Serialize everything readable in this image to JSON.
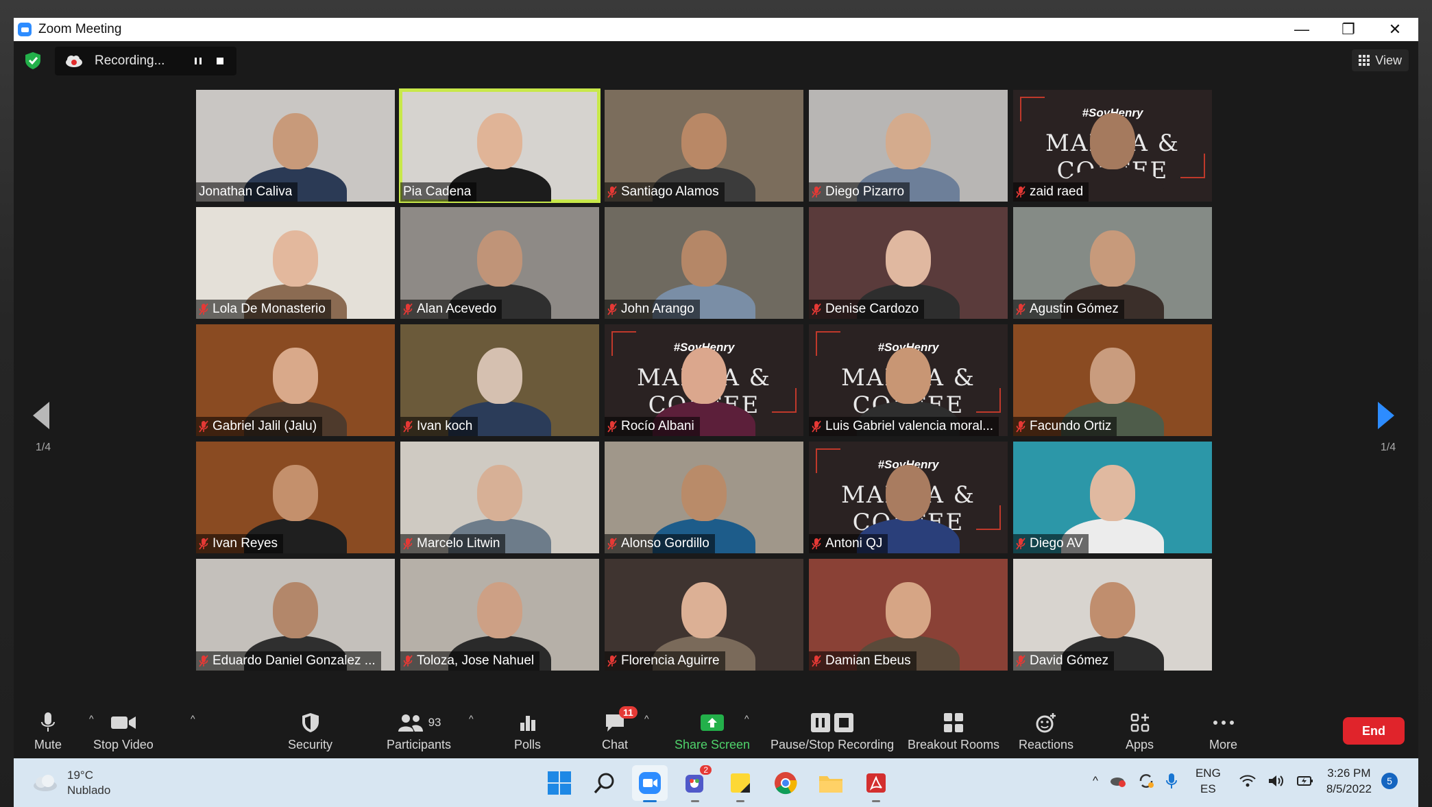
{
  "window": {
    "title": "Zoom Meeting",
    "controls": [
      "—",
      "❐",
      "✕"
    ]
  },
  "recording": {
    "label": "Recording..."
  },
  "view": {
    "label": "View"
  },
  "pagination": {
    "left": "1/4",
    "right": "1/4"
  },
  "participants": [
    {
      "name": "Jonathan Caliva",
      "muted": false,
      "bg": "#c9c6c3",
      "skin": "#c89a7a",
      "shirt": "#2b3a55"
    },
    {
      "name": "Pia Cadena",
      "muted": false,
      "bg": "#d6d3cf",
      "skin": "#e0b497",
      "shirt": "#1c1c1c",
      "speaking": true
    },
    {
      "name": "Santiago Alamos",
      "muted": true,
      "bg": "#7b6d5c",
      "skin": "#b98866",
      "shirt": "#3b3b3b"
    },
    {
      "name": "Diego Pizarro",
      "muted": true,
      "bg": "#b8b6b4",
      "skin": "#d4ab8d",
      "shirt": "#6d7f99"
    },
    {
      "name": "zaid raed",
      "muted": true,
      "bg": "#2a2222",
      "skin": "#a57a5e",
      "shirt": "#2a2222",
      "brand": true
    },
    {
      "name": "Lola De Monasterio",
      "muted": true,
      "bg": "#e4e0d8",
      "skin": "#e3b89d",
      "shirt": "#8b6b52"
    },
    {
      "name": "Alan Acevedo",
      "muted": true,
      "bg": "#8e8a86",
      "skin": "#c09478",
      "shirt": "#2f2f2f"
    },
    {
      "name": "John Arango",
      "muted": true,
      "bg": "#6f6a60",
      "skin": "#b58767",
      "shirt": "#7a8ea6"
    },
    {
      "name": "Denise Cardozo",
      "muted": true,
      "bg": "#5a3b3b",
      "skin": "#e0b8a0",
      "shirt": "#2e2e2e"
    },
    {
      "name": "Agustin Gómez",
      "muted": true,
      "bg": "#858b86",
      "skin": "#c79a7b",
      "shirt": "#3b2f2a"
    },
    {
      "name": "Gabriel Jalil (Jalu)",
      "muted": true,
      "bg": "#8a4b22",
      "skin": "#d9a98a",
      "shirt": "#4e3a2c"
    },
    {
      "name": "Ivan koch",
      "muted": true,
      "bg": "#6b5a3a",
      "skin": "#d5c0b0",
      "shirt": "#2b3c59"
    },
    {
      "name": "Rocío Albani",
      "muted": true,
      "bg": "#2a2222",
      "skin": "#dba78d",
      "shirt": "#5c1f3a",
      "brand": true
    },
    {
      "name": "Luis Gabriel valencia moral...",
      "muted": true,
      "bg": "#2a2222",
      "skin": "#c89674",
      "shirt": "#2e2e2e",
      "brand": true
    },
    {
      "name": "Facundo Ortiz",
      "muted": true,
      "bg": "#8a4b22",
      "skin": "#c99c7e",
      "shirt": "#4e5c4a"
    },
    {
      "name": "Ivan Reyes",
      "muted": true,
      "bg": "#8a4b22",
      "skin": "#c4906c",
      "shirt": "#1f1f1f"
    },
    {
      "name": "Marcelo Litwin",
      "muted": true,
      "bg": "#cfcac2",
      "skin": "#d7b096",
      "shirt": "#6d7c8a"
    },
    {
      "name": "Alonso Gordillo",
      "muted": true,
      "bg": "#a0978a",
      "skin": "#b98b69",
      "shirt": "#1d5c8a"
    },
    {
      "name": "Antoni QJ",
      "muted": true,
      "bg": "#2a2222",
      "skin": "#a97c60",
      "shirt": "#2a3f7a",
      "brand": true
    },
    {
      "name": "Diego AV",
      "muted": true,
      "bg": "#2c97a8",
      "skin": "#e0b9a0",
      "shirt": "#ececec"
    },
    {
      "name": "Eduardo Daniel Gonzalez ...",
      "muted": true,
      "bg": "#c4c0bb",
      "skin": "#b3876a",
      "shirt": "#2f2f2f"
    },
    {
      "name": "Toloza, Jose Nahuel",
      "muted": true,
      "bg": "#b6b0a8",
      "skin": "#cda085",
      "shirt": "#2a2a2a"
    },
    {
      "name": "Florencia Aguirre",
      "muted": true,
      "bg": "#3f3430",
      "skin": "#dcb095",
      "shirt": "#7a6a5a"
    },
    {
      "name": "Damian Ebeus",
      "muted": true,
      "bg": "#8a4136",
      "skin": "#d6a585",
      "shirt": "#5a4a3a"
    },
    {
      "name": "David Gómez",
      "muted": true,
      "bg": "#d8d4cf",
      "skin": "#c08e6e",
      "shirt": "#2c2c2c"
    }
  ],
  "brand": {
    "top": "#SoyHenry",
    "main": "MANGA & COFFEE"
  },
  "toolbar": {
    "mute": "Mute",
    "stop_video": "Stop Video",
    "security": "Security",
    "participants": "Participants",
    "participants_count": "93",
    "polls": "Polls",
    "chat": "Chat",
    "chat_badge": "11",
    "share_screen": "Share Screen",
    "pause_stop": "Pause/Stop Recording",
    "breakout": "Breakout Rooms",
    "reactions": "Reactions",
    "apps": "Apps",
    "more": "More",
    "end": "End"
  },
  "taskbar": {
    "weather_temp": "19°C",
    "weather_desc": "Nublado",
    "teams_badge": "2",
    "lang_top": "ENG",
    "lang_bottom": "ES",
    "time": "3:26 PM",
    "date": "8/5/2022",
    "notifications": "5"
  },
  "colors": {
    "accent": "#2d8cff",
    "speaker_outline": "#c8e84a",
    "share_green": "#23b04a",
    "end_red": "#e0242b"
  }
}
